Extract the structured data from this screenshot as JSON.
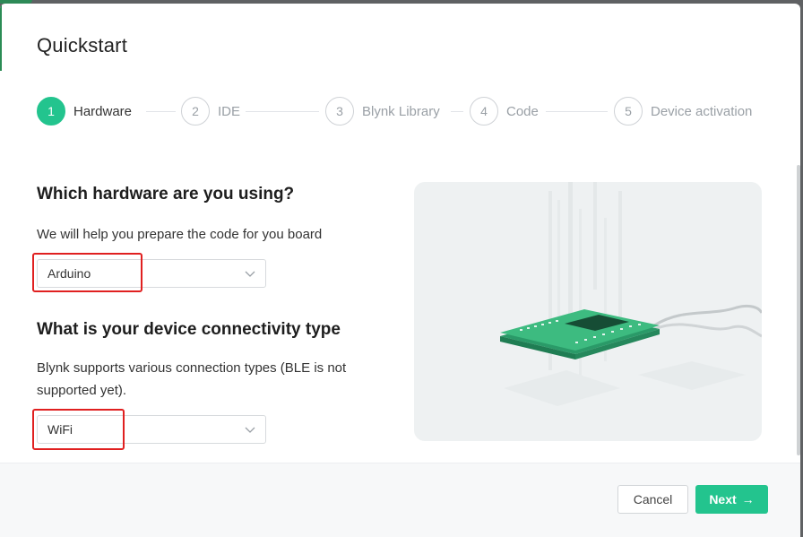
{
  "dialog": {
    "title": "Quickstart"
  },
  "steps": [
    {
      "number": "1",
      "label": "Hardware",
      "active": true
    },
    {
      "number": "2",
      "label": "IDE",
      "active": false
    },
    {
      "number": "3",
      "label": "Blynk Library",
      "active": false
    },
    {
      "number": "4",
      "label": "Code",
      "active": false
    },
    {
      "number": "5",
      "label": "Device activation",
      "active": false
    }
  ],
  "hardware": {
    "heading": "Which hardware are you using?",
    "description": "We will help you prepare the code for you board",
    "selected": "Arduino"
  },
  "connectivity": {
    "heading": "What is your device connectivity type",
    "description": "Blynk supports various connection types (BLE is not supported yet).",
    "selected": "WiFi"
  },
  "footer": {
    "cancel_label": "Cancel",
    "next_label": "Next",
    "next_icon": "arrow-right-icon"
  },
  "colors": {
    "accent": "#23c48e",
    "highlight": "#e02020",
    "illustration_bg": "#eef1f2"
  }
}
